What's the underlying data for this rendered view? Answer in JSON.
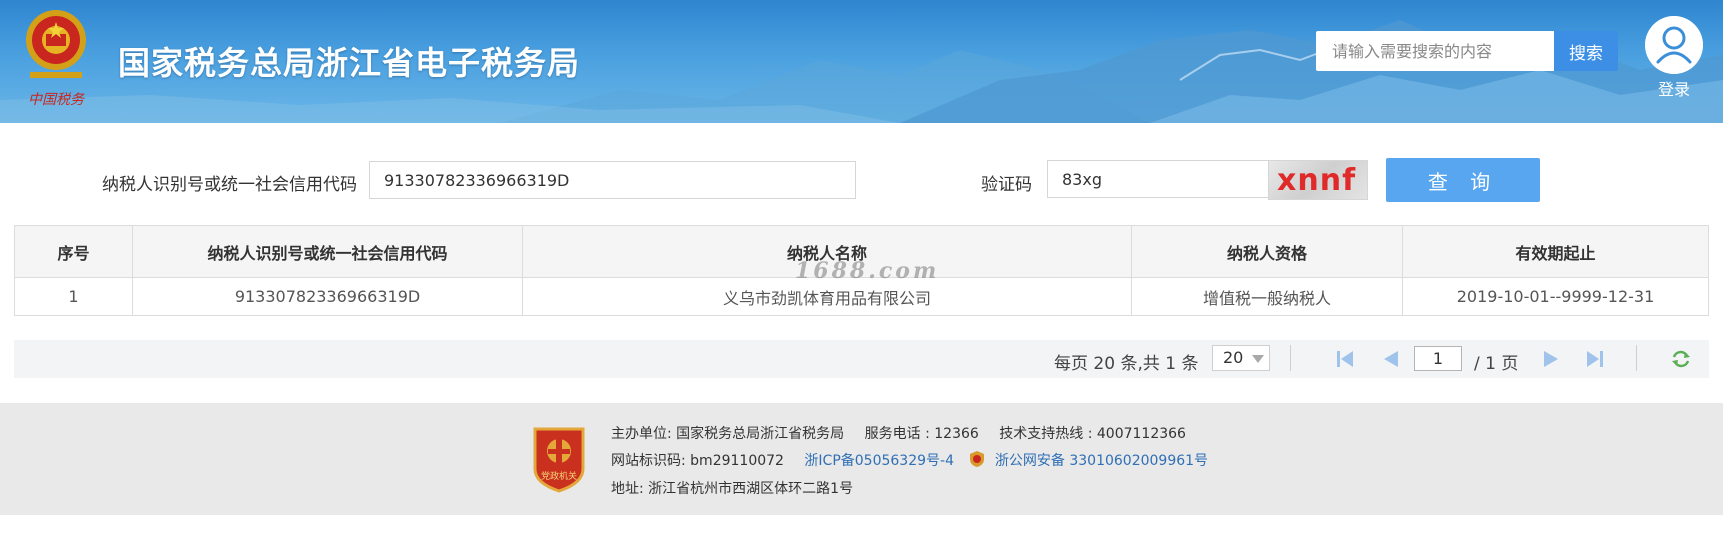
{
  "header": {
    "site_title": "国家税务总局浙江省电子税务局",
    "search_placeholder": "请输入需要搜索的内容",
    "search_button": "搜索",
    "login_label": "登录"
  },
  "query_form": {
    "taxid_label": "纳税人识别号或统一社会信用代码",
    "taxid_value": "91330782336966319D",
    "captcha_label": "验证码",
    "captcha_value": "83xg",
    "captcha_image_text": "xnnf",
    "query_button": "查 询"
  },
  "result_table": {
    "columns": [
      "序号",
      "纳税人识别号或统一社会信用代码",
      "纳税人名称",
      "纳税人资格",
      "有效期起止"
    ],
    "rows": [
      [
        "1",
        "91330782336966319D",
        "义乌市劲凯体育用品有限公司",
        "增值税一般纳税人",
        "2019-10-01--9999-12-31"
      ]
    ]
  },
  "watermark": "1688.com",
  "pagination": {
    "info": "每页 20 条,共 1 条",
    "page_size": "20",
    "current_page": "1",
    "total_pages": "/ 1 页"
  },
  "footer": {
    "host_label": "主办单位:",
    "host": "国家税务总局浙江省税务局",
    "phone_label": "服务电话 : ",
    "phone": "12366",
    "support_label": "技术支持热线 : ",
    "support": "4007112366",
    "site_id_label": "网站标识码:",
    "site_id": "bm29110072",
    "icp": "浙ICP备05056329号-4",
    "police": "浙公网安备 33010602009961号",
    "address_label": "地址:",
    "address": "浙江省杭州市西湖区体环二路1号",
    "badge_text": "党政机关"
  },
  "colors": {
    "banner": "#3a93d8",
    "primary_button": "#58a6ef",
    "search_button": "#3d8fe6",
    "captcha_text": "#e02a2a",
    "link": "#2f6fb5"
  }
}
